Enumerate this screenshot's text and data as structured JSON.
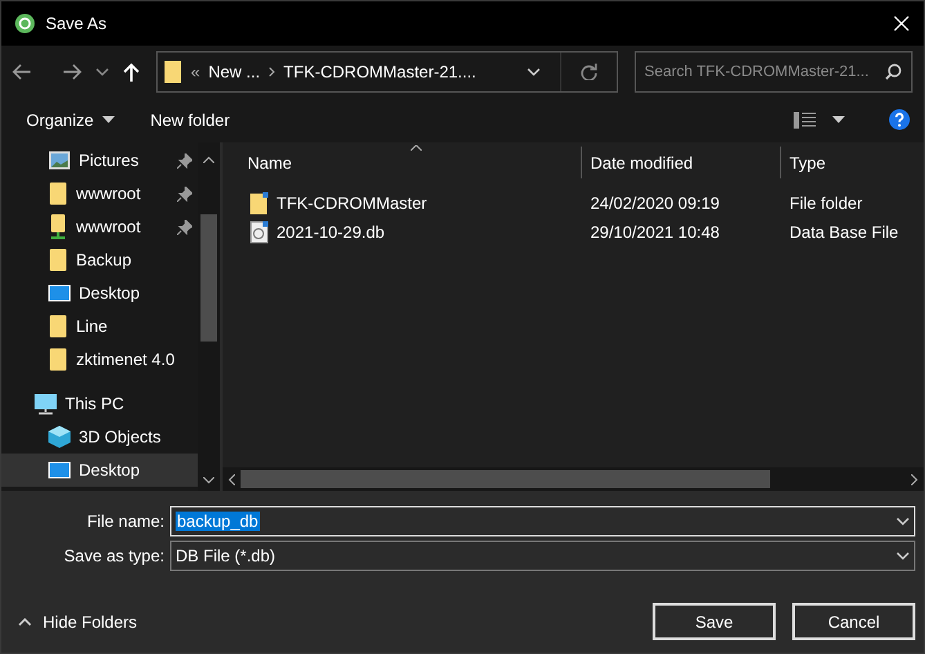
{
  "window": {
    "title": "Save As"
  },
  "address_bar": {
    "overflow": "«",
    "crumbs": [
      "New ...",
      "TFK-CDROMMaster-21...."
    ]
  },
  "search": {
    "placeholder": "Search TFK-CDROMMaster-21..."
  },
  "toolbar": {
    "organize": "Organize",
    "new_folder": "New folder"
  },
  "sidebar": {
    "quick_access": [
      {
        "label": "Pictures",
        "kind": "pictures",
        "pinned": true,
        "selected": false
      },
      {
        "label": "wwwroot",
        "kind": "folder",
        "pinned": true,
        "selected": false
      },
      {
        "label": "wwwroot",
        "kind": "network-folder",
        "pinned": true,
        "selected": false
      },
      {
        "label": "Backup",
        "kind": "folder",
        "pinned": false,
        "selected": false
      },
      {
        "label": "Desktop",
        "kind": "desktop",
        "pinned": false,
        "selected": false
      },
      {
        "label": "Line",
        "kind": "folder",
        "pinned": false,
        "selected": false
      },
      {
        "label": "zktimenet 4.0",
        "kind": "folder",
        "pinned": false,
        "selected": false
      }
    ],
    "this_pc": {
      "label": "This PC",
      "kind": "pc",
      "selected": false,
      "children": [
        {
          "label": "3D Objects",
          "kind": "objects3d",
          "selected": false
        },
        {
          "label": "Desktop",
          "kind": "desktop",
          "selected": true
        }
      ]
    }
  },
  "table": {
    "columns": [
      "Name",
      "Date modified",
      "Type"
    ],
    "rows": [
      {
        "kind": "folder",
        "name": "TFK-CDROMMaster",
        "date": "24/02/2020 09:19",
        "type": "File folder"
      },
      {
        "kind": "file",
        "name": "2021-10-29.db",
        "date": "29/10/2021 10:48",
        "type": "Data Base File"
      }
    ]
  },
  "form": {
    "file_name_label": "File name:",
    "file_name": "backup_db",
    "type_label": "Save as type:",
    "type_value": "DB File (*.db)"
  },
  "footer": {
    "hide_folders": "Hide Folders",
    "save": "Save",
    "cancel": "Cancel"
  }
}
